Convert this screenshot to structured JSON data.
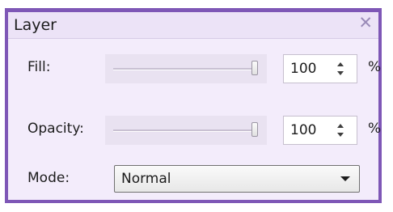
{
  "panel": {
    "title": "Layer",
    "close_icon": "close-icon",
    "accent_color": "#7e57b6"
  },
  "fill": {
    "label": "Fill:",
    "slider_percent": 100,
    "value": "100",
    "unit": "%"
  },
  "opacity": {
    "label": "Opacity:",
    "slider_percent": 100,
    "value": "100",
    "unit": "%"
  },
  "mode": {
    "label": "Mode:",
    "selected": "Normal"
  }
}
